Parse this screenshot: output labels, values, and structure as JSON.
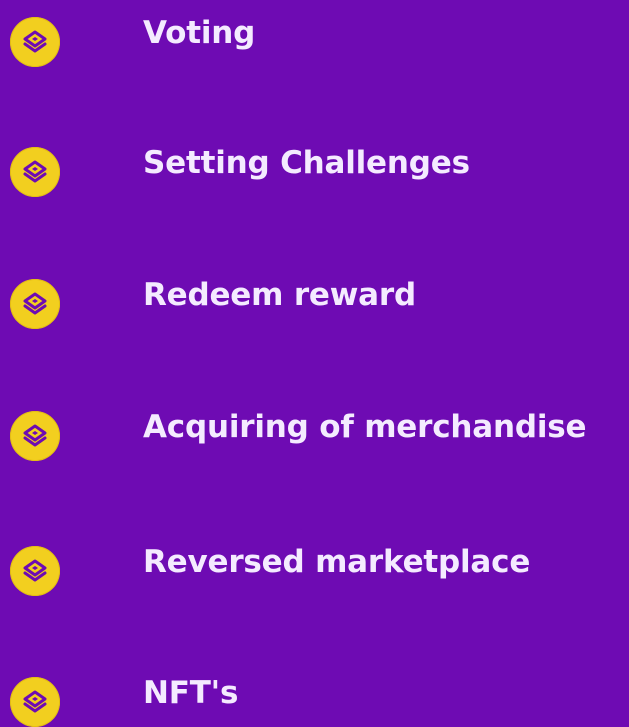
{
  "colors": {
    "background": "#6e0bb3",
    "icon_fill": "#f2cf1f",
    "icon_mark": "#6e0bb3",
    "text": "#f4ebff"
  },
  "items": [
    {
      "icon": "layered-token-icon",
      "label": "Voting"
    },
    {
      "icon": "layered-token-icon",
      "label": "Setting Challenges"
    },
    {
      "icon": "layered-token-icon",
      "label": "Redeem reward"
    },
    {
      "icon": "layered-token-icon",
      "label": "Acquiring of merchandise"
    },
    {
      "icon": "layered-token-icon",
      "label": "Reversed marketplace"
    },
    {
      "icon": "layered-token-icon",
      "label": "NFT's"
    }
  ]
}
